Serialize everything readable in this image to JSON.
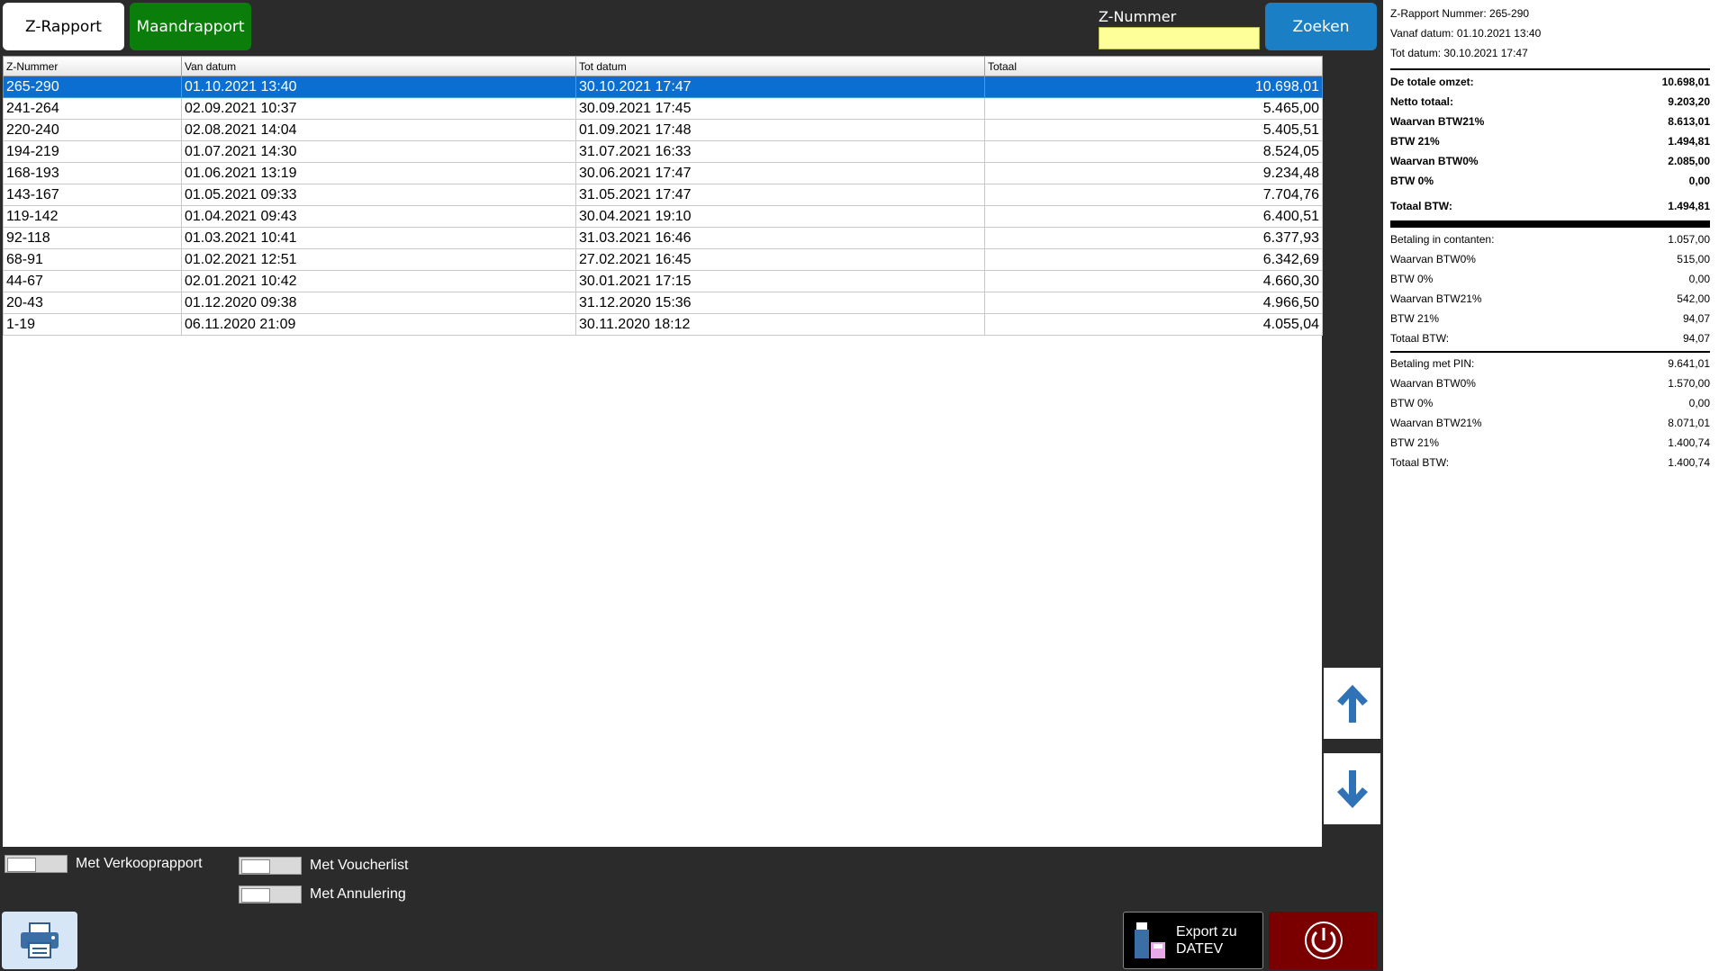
{
  "tabs": {
    "z_rapport": "Z-Rapport",
    "maandrapport": "Maandrapport"
  },
  "search": {
    "label": "Z-Nummer",
    "value": "",
    "button": "Zoeken"
  },
  "table": {
    "headers": [
      "Z-Nummer",
      "Van datum",
      "Tot datum",
      "Totaal"
    ],
    "rows": [
      [
        "265-290",
        "01.10.2021 13:40",
        "30.10.2021 17:47",
        "10.698,01"
      ],
      [
        "241-264",
        "02.09.2021 10:37",
        "30.09.2021 17:45",
        "5.465,00"
      ],
      [
        "220-240",
        "02.08.2021 14:04",
        "01.09.2021 17:48",
        "5.405,51"
      ],
      [
        "194-219",
        "01.07.2021 14:30",
        "31.07.2021 16:33",
        "8.524,05"
      ],
      [
        "168-193",
        "01.06.2021 13:19",
        "30.06.2021 17:47",
        "9.234,48"
      ],
      [
        "143-167",
        "01.05.2021 09:33",
        "31.05.2021 17:47",
        "7.704,76"
      ],
      [
        "119-142",
        "01.04.2021 09:43",
        "30.04.2021 19:10",
        "6.400,51"
      ],
      [
        "92-118",
        "01.03.2021 10:41",
        "31.03.2021 16:46",
        "6.377,93"
      ],
      [
        "68-91",
        "01.02.2021 12:51",
        "27.02.2021 16:45",
        "6.342,69"
      ],
      [
        "44-67",
        "02.01.2021 10:42",
        "30.01.2021 17:15",
        "4.660,30"
      ],
      [
        "20-43",
        "01.12.2020 09:38",
        "31.12.2020 15:36",
        "4.966,50"
      ],
      [
        "1-19",
        "06.11.2020 21:09",
        "30.11.2020 18:12",
        "4.055,04"
      ]
    ],
    "selected_row": 0
  },
  "options": {
    "verkooprapport": "Met Verkooprapport",
    "voucherlist": "Met Voucherlist",
    "annulering": "Met Annulering"
  },
  "actions": {
    "export_line1": "Export zu",
    "export_line2": "DATEV",
    "print_icon": "printer-icon",
    "power_icon": "power-icon"
  },
  "colors": {
    "accent_blue": "#1a7fc4",
    "green": "#0a7d0a",
    "selected_row": "#0a6fd1",
    "power_red": "#7a0000",
    "search_bg": "#ffff99"
  },
  "report": {
    "header": [
      "Z-Rapport Nummer: 265-290",
      "Vanaf datum: 01.10.2021 13:40",
      "Tot datum: 30.10.2021 17:47"
    ],
    "summary": [
      {
        "label": "De totale omzet:",
        "value": "10.698,01"
      },
      {
        "label": "Netto totaal:",
        "value": "9.203,20"
      },
      {
        "label": "Waarvan BTW21%",
        "value": "8.613,01"
      },
      {
        "label": "BTW 21%",
        "value": "1.494,81"
      },
      {
        "label": "Waarvan BTW0%",
        "value": "2.085,00"
      },
      {
        "label": "BTW 0%",
        "value": "0,00"
      }
    ],
    "total_btw": {
      "label": "Totaal BTW:",
      "value": "1.494,81"
    },
    "cash": [
      {
        "label": "Betaling in contanten:",
        "value": "1.057,00"
      },
      {
        "label": "Waarvan BTW0%",
        "value": "515,00"
      },
      {
        "label": "BTW 0%",
        "value": "0,00"
      },
      {
        "label": "Waarvan BTW21%",
        "value": "542,00"
      },
      {
        "label": "BTW 21%",
        "value": "94,07"
      },
      {
        "label": "Totaal BTW:",
        "value": "94,07"
      }
    ],
    "pin": [
      {
        "label": "Betaling met PIN:",
        "value": "9.641,01"
      },
      {
        "label": "Waarvan BTW0%",
        "value": "1.570,00"
      },
      {
        "label": "BTW 0%",
        "value": "0,00"
      },
      {
        "label": "Waarvan BTW21%",
        "value": "8.071,01"
      },
      {
        "label": "BTW 21%",
        "value": "1.400,74"
      },
      {
        "label": "Totaal BTW:",
        "value": "1.400,74"
      }
    ]
  }
}
